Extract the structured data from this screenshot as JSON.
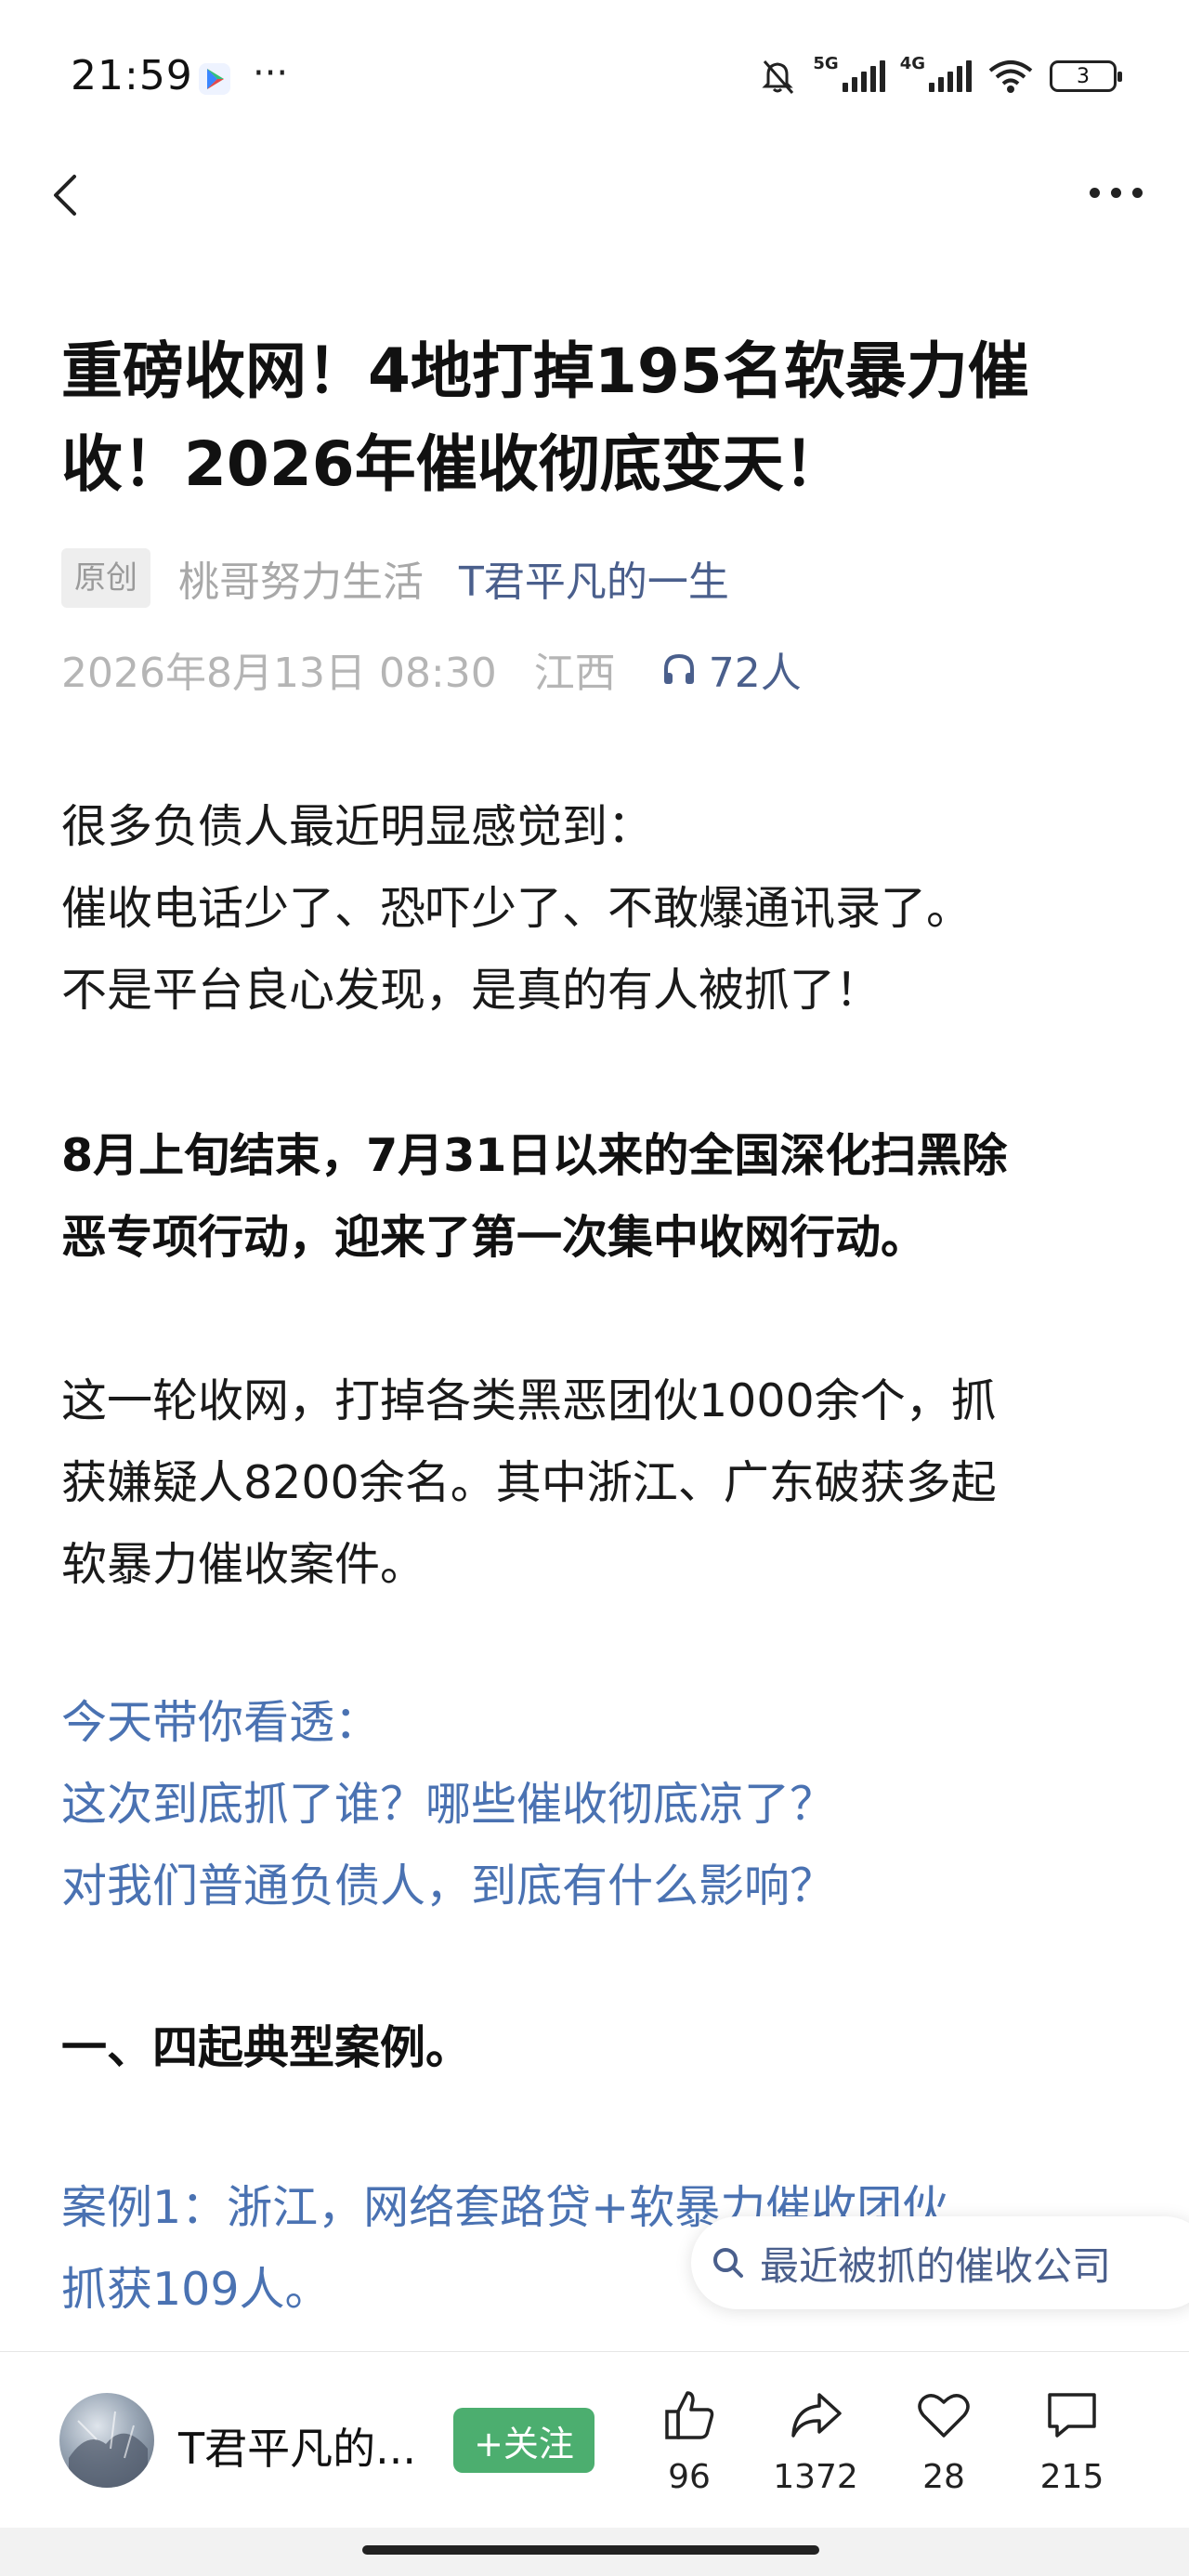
{
  "status_bar": {
    "time": "21:59",
    "more": "···",
    "sim1": "5G",
    "sim2": "4G",
    "battery": "3"
  },
  "article": {
    "title_lines": [
      "重磅收网！4地打掉195名软暴力催",
      "收！2026年催收彻底变天！"
    ],
    "original_badge": "原创",
    "author": "桃哥努力生活",
    "account": "T君平凡的一生",
    "date": "2026年8月13日 08:30",
    "location": "江西",
    "listeners": "72人",
    "p1": [
      "很多负债人最近明显感觉到：",
      "催收电话少了、恐吓少了、不敢爆通讯录了。",
      "不是平台良心发现，是真的有人被抓了！"
    ],
    "p2": [
      "8月上旬结束，7月31日以来的全国深化扫黑除",
      "恶专项行动，迎来了第一次集中收网行动。"
    ],
    "p3": [
      "这一轮收网，打掉各类黑恶团伙1000余个，抓",
      "获嫌疑人8200余名。其中浙江、广东破获多起",
      "软暴力催收案件。"
    ],
    "p4": [
      "今天带你看透：",
      "这次到底抓了谁？哪些催收彻底凉了？",
      "对我们普通负债人，到底有什么影响？"
    ],
    "p5": "一、四起典型案例。",
    "p6": [
      "案例1：浙江，网络套路贷+软暴力催收团伙",
      "抓获109人。"
    ]
  },
  "search_pill": {
    "text": "最近被抓的催收公司"
  },
  "bottom_bar": {
    "account_name": "T君平凡的...",
    "follow_label": "+关注",
    "like_count": "96",
    "share_count": "1372",
    "favorite_count": "28",
    "comment_count": "215"
  },
  "colors": {
    "link_blue": "#4a72b2",
    "account_blue": "#4a5f8c",
    "follow_green": "#4cae6f"
  }
}
